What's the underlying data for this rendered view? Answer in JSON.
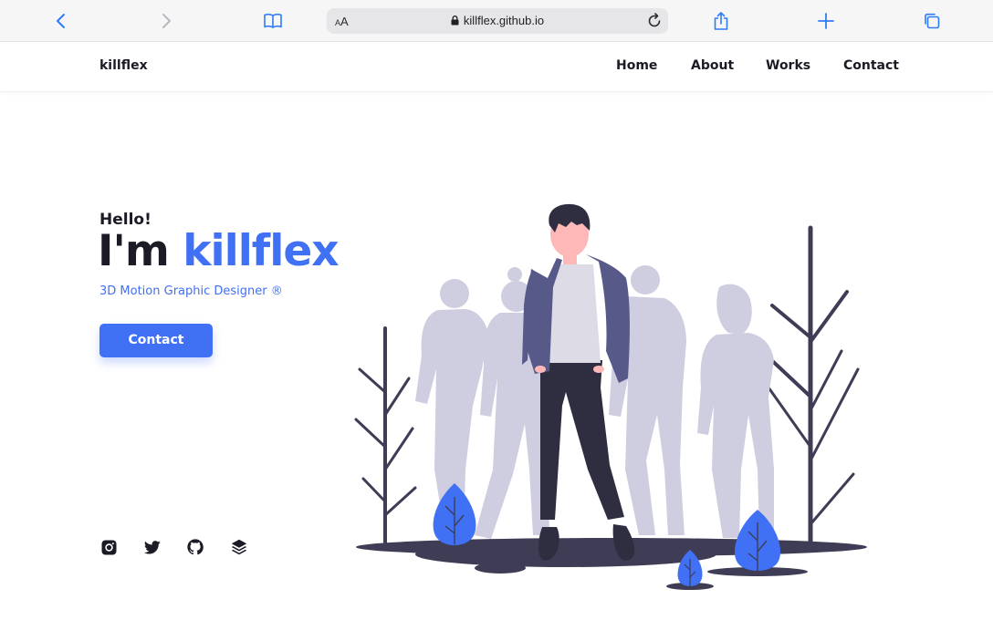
{
  "browser": {
    "text_size_small": "A",
    "text_size_large": "A",
    "url": "killflex.github.io",
    "icons": [
      "back-chevron-icon",
      "forward-chevron-icon",
      "bookmarks-book-icon",
      "lock-icon",
      "reload-icon",
      "share-icon",
      "new-tab-plus-icon",
      "tabs-overview-icon"
    ]
  },
  "site": {
    "logo": "killflex",
    "nav": [
      "Home",
      "About",
      "Works",
      "Contact"
    ]
  },
  "hero": {
    "greeting": "Hello!",
    "title_prefix": "I'm ",
    "title_name": "killflex",
    "subtitle": "3D Motion Graphic Designer ®",
    "cta": "Contact"
  },
  "social": {
    "icons": [
      "instagram-icon",
      "twitter-icon",
      "github-icon",
      "layers-icon"
    ]
  },
  "colors": {
    "accent": "#4070f4",
    "text_dark": "#1b1b26",
    "silhouette": "#cfcde0",
    "jacket": "#575a89",
    "ground": "#3f3d56"
  }
}
